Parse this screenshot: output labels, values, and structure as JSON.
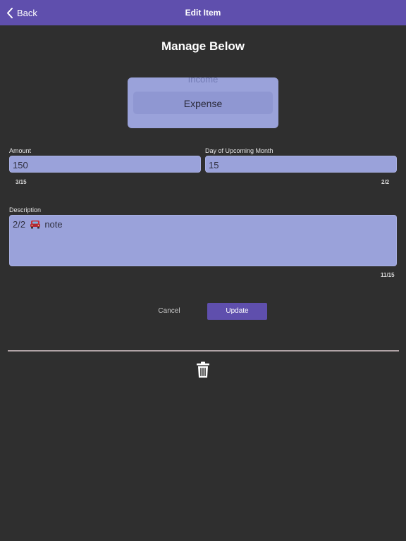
{
  "navbar": {
    "back_label": "Back",
    "title": "Edit Item",
    "background": "#5f4fad"
  },
  "main": {
    "title": "Manage Below",
    "type_picker": {
      "options": [
        "Income",
        "Expense"
      ],
      "selected": "Expense"
    },
    "amount": {
      "label": "Amount",
      "value": "150",
      "counter": "3/15"
    },
    "day": {
      "label": "Day of Upcoming Month",
      "value": "15",
      "counter": "2/2"
    },
    "description": {
      "label": "Description",
      "value_before": "2/2",
      "value_after": "note",
      "emoji_icon": "car-icon",
      "counter": "11/15"
    },
    "cancel_label": "Cancel",
    "update_label": "Update",
    "delete_icon": "trash-icon"
  }
}
